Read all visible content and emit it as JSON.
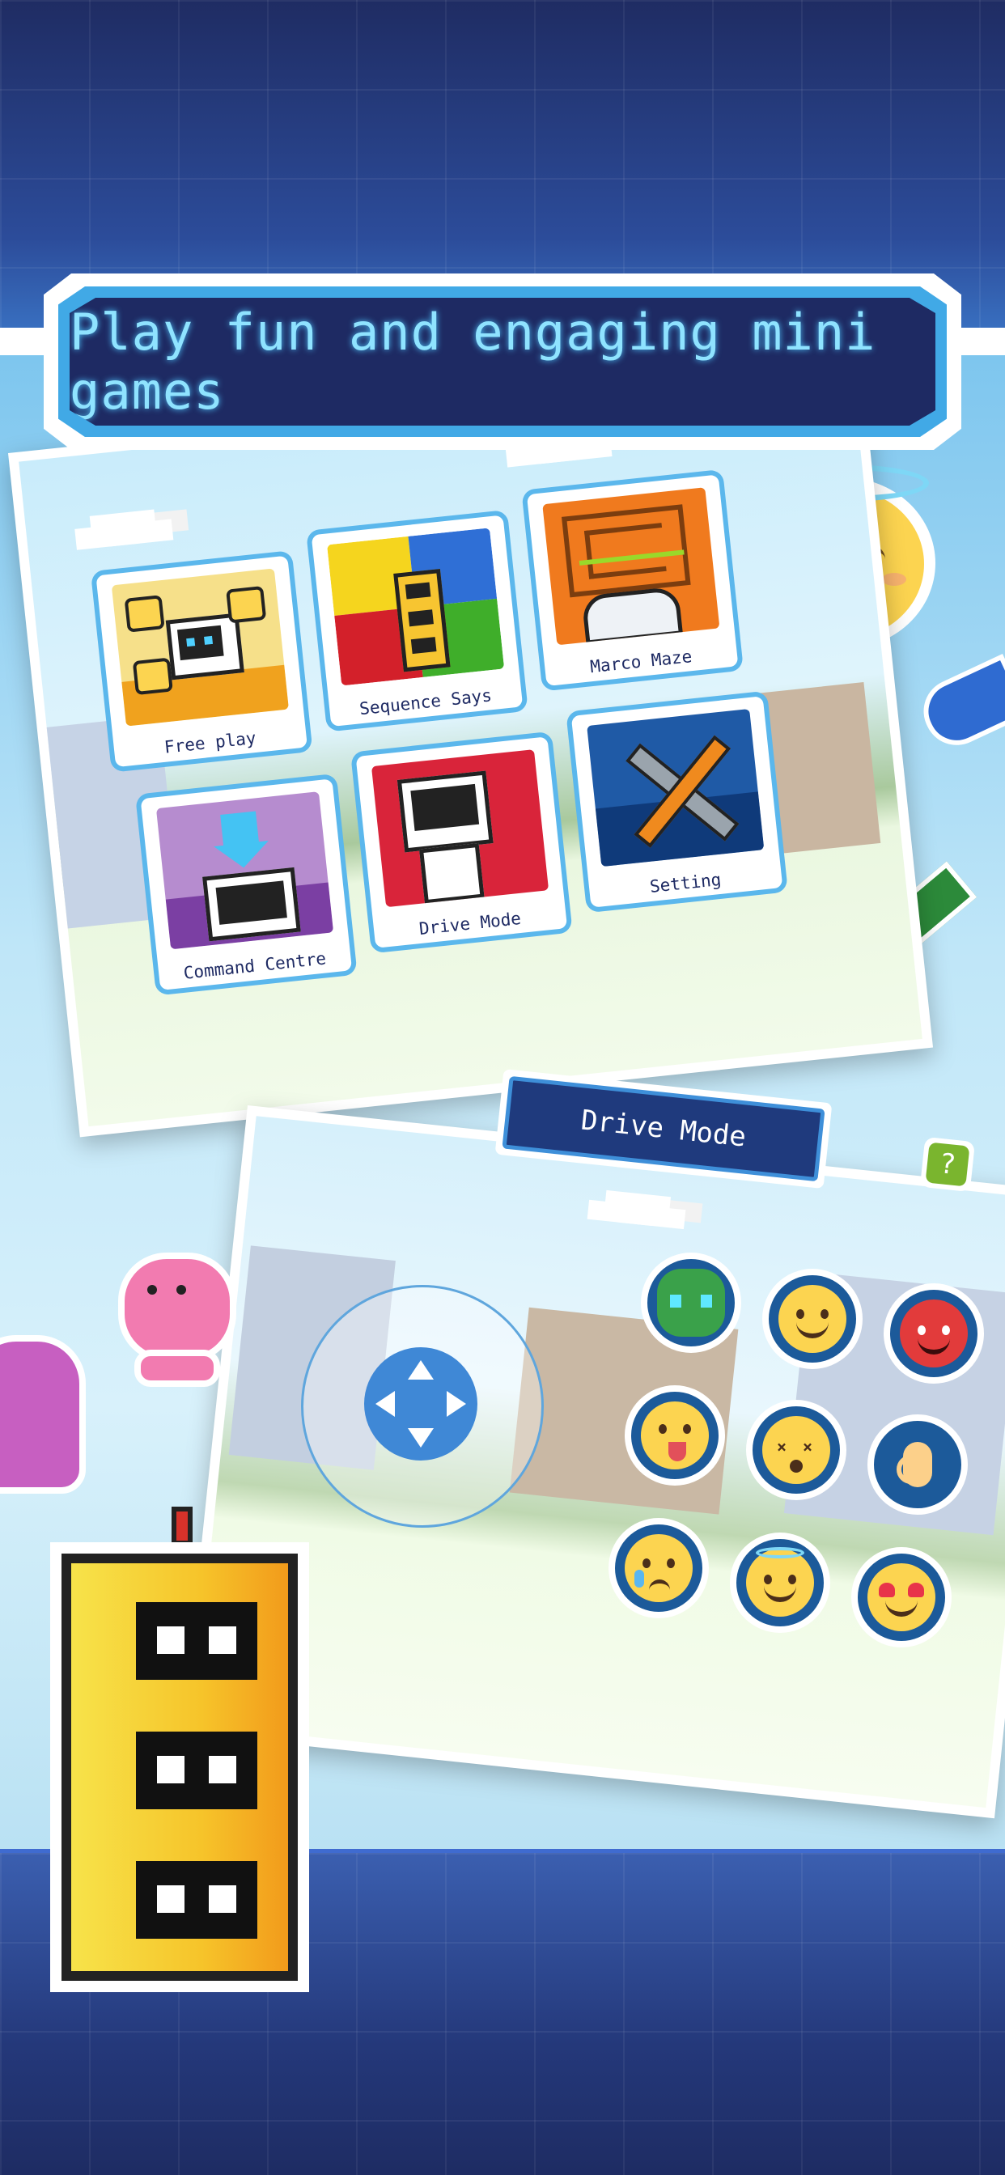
{
  "banner": {
    "title": "Play fun and engaging mini games"
  },
  "menu_screen": {
    "tiles": [
      {
        "label": "Free play"
      },
      {
        "label": "Sequence Says"
      },
      {
        "label": "Marco Maze"
      },
      {
        "label": "Command Centre"
      },
      {
        "label": "Drive Mode"
      },
      {
        "label": "Setting"
      }
    ]
  },
  "drive_screen": {
    "title": "Drive Mode",
    "help_symbol": "?",
    "emoji_buttons": [
      "robot-face",
      "blush",
      "devil",
      "tongue-out",
      "dizzy",
      "ok-hand",
      "crying",
      "halo",
      "heart-eyes"
    ]
  },
  "colors": {
    "accent_blue": "#41a9e6",
    "navy": "#1e2a63",
    "banner_text": "#8fe3ff"
  }
}
